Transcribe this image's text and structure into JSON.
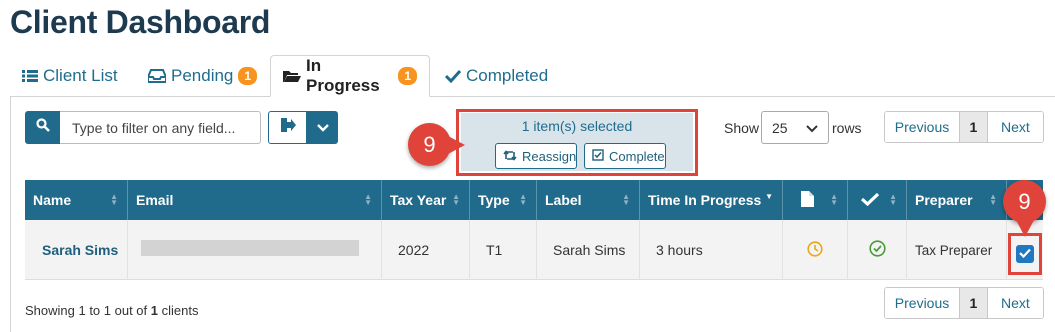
{
  "page": {
    "title": "Client Dashboard"
  },
  "tabs": [
    {
      "label": "Client List",
      "icon": "list-icon",
      "badge": null,
      "active": false
    },
    {
      "label": "Pending",
      "icon": "inbox-icon",
      "badge": "1",
      "active": false
    },
    {
      "label": "In Progress",
      "icon": "folder-open-icon",
      "badge": "1",
      "active": true
    },
    {
      "label": "Completed",
      "icon": "check-icon",
      "badge": null,
      "active": false
    }
  ],
  "toolbar": {
    "search_placeholder": "Type to filter on any field...",
    "selection_text": "1 item(s) selected",
    "reassign_label": "Reassign",
    "complete_label": "Complete",
    "show_label": "Show",
    "rows_value": "25",
    "rows_label": "rows"
  },
  "callouts": {
    "left": "9",
    "right": "9"
  },
  "pagination": {
    "prev": "Previous",
    "page": "1",
    "next": "Next"
  },
  "table": {
    "columns": [
      "Name",
      "Email",
      "Tax Year",
      "Type",
      "Label",
      "Time In Progress",
      "",
      "",
      "Preparer",
      ""
    ],
    "rows": [
      {
        "name": "Sarah Sims",
        "email": "",
        "tax_year": "2022",
        "type": "T1",
        "label": "Sarah Sims",
        "time": "3 hours",
        "doc_status": "clock-icon",
        "check_status": "check-circle-icon",
        "preparer": "Tax Preparer",
        "selected": true
      }
    ]
  },
  "footer": {
    "prefix": "Showing 1 to 1 out of ",
    "count": "1",
    "suffix": " clients"
  },
  "colors": {
    "primary": "#206a8b",
    "accent_orange": "#f7931e",
    "callout_red": "#e0433a",
    "title": "#1d3a4f"
  }
}
